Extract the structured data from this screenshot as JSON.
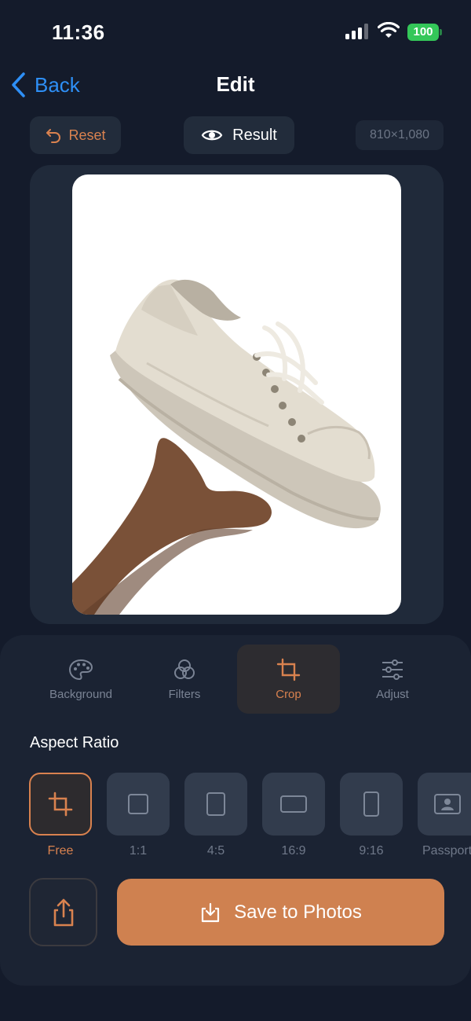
{
  "status_bar": {
    "time": "11:36",
    "battery": "100"
  },
  "nav": {
    "back_label": "Back",
    "title": "Edit"
  },
  "toolbar": {
    "reset_label": "Reset",
    "result_label": "Result",
    "dimensions": "810×1,080"
  },
  "tabs": [
    {
      "label": "Background",
      "icon": "palette-icon"
    },
    {
      "label": "Filters",
      "icon": "filters-icon"
    },
    {
      "label": "Crop",
      "icon": "crop-icon",
      "active": true
    },
    {
      "label": "Adjust",
      "icon": "sliders-icon"
    }
  ],
  "aspect_ratio": {
    "heading": "Aspect Ratio",
    "options": [
      {
        "label": "Free",
        "icon": "crop-icon",
        "selected": true
      },
      {
        "label": "1:1",
        "icon": "square-icon"
      },
      {
        "label": "4:5",
        "icon": "portrait-rect-icon"
      },
      {
        "label": "16:9",
        "icon": "landscape-rect-icon"
      },
      {
        "label": "9:16",
        "icon": "tall-rect-icon"
      },
      {
        "label": "Passport",
        "icon": "passport-icon"
      }
    ]
  },
  "actions": {
    "save_label": "Save to Photos"
  },
  "colors": {
    "accent": "#d9824f",
    "save_button": "#cf8150",
    "link": "#2e8ff6",
    "background": "#141b2b"
  }
}
